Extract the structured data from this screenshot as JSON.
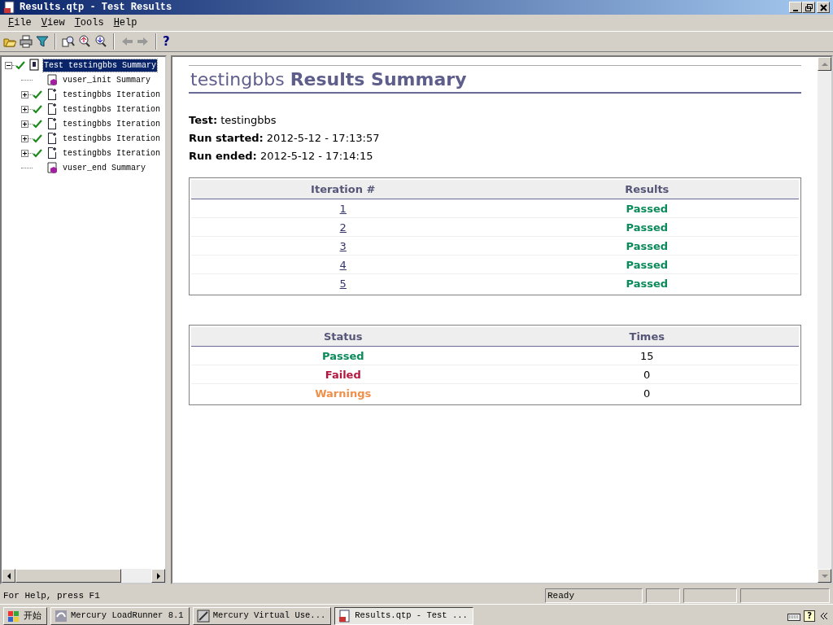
{
  "window": {
    "title": "Results.qtp - Test Results"
  },
  "menu": [
    "File",
    "View",
    "Tools",
    "Help"
  ],
  "toolbar": {
    "help": "?"
  },
  "tree": {
    "label": "Test testingbbs Summary",
    "kind": "test",
    "passed": true,
    "expanded": true,
    "selected": true,
    "children": [
      {
        "label": "vuser_init Summary",
        "kind": "action",
        "passed": false,
        "expandable": false
      },
      {
        "label": "testingbbs Iteration",
        "kind": "iteration",
        "passed": true,
        "expandable": true,
        "expanded": false
      },
      {
        "label": "testingbbs Iteration",
        "kind": "iteration",
        "passed": true,
        "expandable": true,
        "expanded": false
      },
      {
        "label": "testingbbs Iteration",
        "kind": "iteration",
        "passed": true,
        "expandable": true,
        "expanded": false
      },
      {
        "label": "testingbbs Iteration",
        "kind": "iteration",
        "passed": true,
        "expandable": true,
        "expanded": false
      },
      {
        "label": "testingbbs Iteration",
        "kind": "iteration",
        "passed": true,
        "expandable": true,
        "expanded": false
      },
      {
        "label": "vuser_end Summary",
        "kind": "action",
        "passed": false,
        "expandable": false
      }
    ]
  },
  "report": {
    "heading": "testingbbs **Results Summary**",
    "info": [
      "**Test:** testingbbs",
      "**Run started:** 2012-5-12 - 17:13:57",
      "**Run ended:** 2012-5-12 - 17:14:15"
    ],
    "iterations": {
      "columns": [
        "Iteration #",
        "Results"
      ],
      "rows": [
        {
          "iteration": "1",
          "result": "Passed",
          "color": "#0b8a5a"
        },
        {
          "iteration": "2",
          "result": "Passed",
          "color": "#0b8a5a"
        },
        {
          "iteration": "3",
          "result": "Passed",
          "color": "#0b8a5a"
        },
        {
          "iteration": "4",
          "result": "Passed",
          "color": "#0b8a5a"
        },
        {
          "iteration": "5",
          "result": "Passed",
          "color": "#0b8a5a"
        }
      ]
    },
    "totals": {
      "columns": [
        "Status",
        "Times"
      ],
      "rows": [
        {
          "label": "Passed",
          "times": "15",
          "color": "#0b8a5a"
        },
        {
          "label": "Failed",
          "times": "0",
          "color": "#b3173f"
        },
        {
          "label": "Warnings",
          "times": "0",
          "color": "#f0904a"
        }
      ]
    }
  },
  "status_bar": {
    "help": "For Help, press F1",
    "panes": [
      "Ready"
    ]
  },
  "taskbar": {
    "start": "开始",
    "tasks": [
      {
        "label": "Mercury LoadRunner 8.1",
        "selected": false
      },
      {
        "label": "Mercury Virtual Use...",
        "selected": false
      },
      {
        "label": "Results.qtp - Test ...",
        "selected": true
      }
    ],
    "tray_help": "?"
  }
}
